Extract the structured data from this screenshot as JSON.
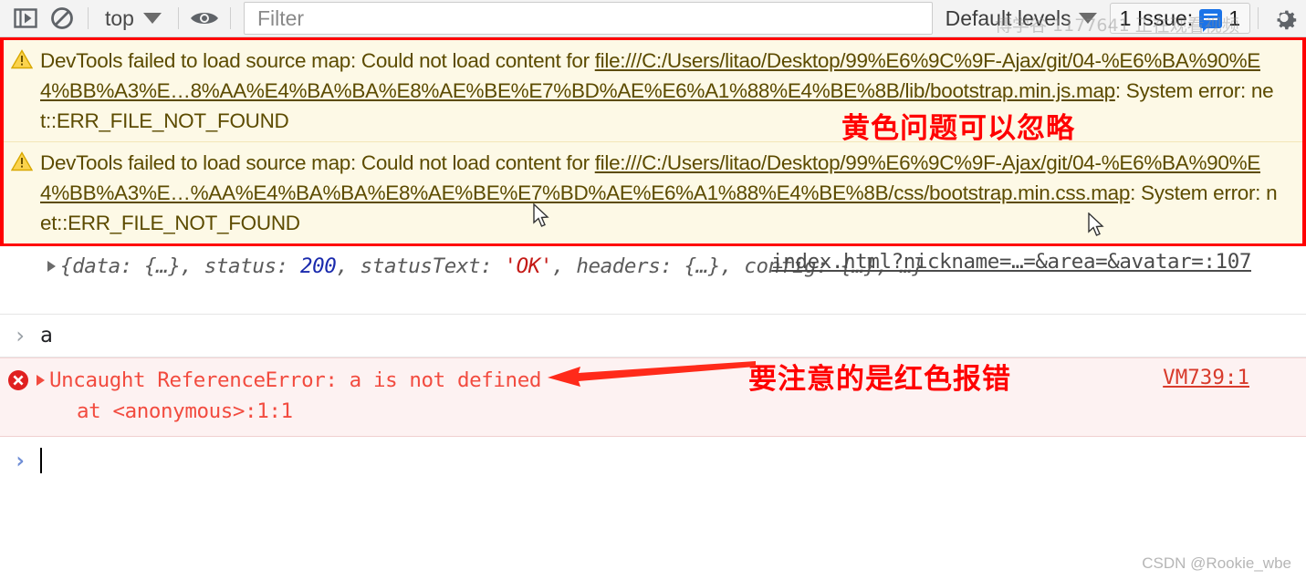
{
  "toolbar": {
    "sidebar_toggle_icon": "sidebar-play-icon",
    "clear_console_icon": "clear-console-icon",
    "context_label": "top",
    "context_caret_icon": "chevron-down-icon",
    "eye_icon": "eye-icon",
    "filter_placeholder": "Filter",
    "filter_value": "",
    "levels_label": "Default levels",
    "levels_caret_icon": "chevron-down-icon",
    "issues_label": "1 Issue:",
    "issues_chip_icon": "issue-message-icon",
    "issues_count": "1",
    "settings_icon": "gear-icon"
  },
  "console": {
    "warnings": [
      {
        "icon": "warning-triangle-icon",
        "prefix": "DevTools failed to load source map: Could not load content for ",
        "link": "file:///C:/Users/litao/Desktop/99%E6%9C%9F-Ajax/git/04-%E6%BA%90%E4%BB%A3%E…8%AA%E4%BA%BA%E8%AE%BE%E7%BD%AE%E6%A1%88%E4%BE%8B/lib/bootstrap.min.js.map",
        "suffix": ": System error: net::ERR_FILE_NOT_FOUND"
      },
      {
        "icon": "warning-triangle-icon",
        "prefix": "DevTools failed to load source map: Could not load content for ",
        "link": "file:///C:/Users/litao/Desktop/99%E6%9C%9F-Ajax/git/04-%E6%BA%90%E4%BB%A3%E…%AA%E4%BA%BA%E8%AE%BE%E7%BD%AE%E6%A1%88%E4%BE%8B/css/bootstrap.min.css.map",
        "suffix": ": System error: net::ERR_FILE_NOT_FOUND"
      }
    ],
    "object_result": {
      "source_link": "index.html?nickname=…=&area=&avatar=:107",
      "part1": "{data: {…}, status: ",
      "status_value": "200",
      "part2": ", statusText: ",
      "status_text_value": "'OK'",
      "part3": ", headers: {…}, config: {…}, …}"
    },
    "user_input": {
      "prompt": "›",
      "text": "a"
    },
    "error": {
      "icon": "error-circle-icon",
      "line1": "Uncaught ReferenceError: a is not defined",
      "line2": "at <anonymous>:1:1",
      "source_link": "VM739:1"
    },
    "empty_prompt": {
      "prompt": "›",
      "value": ""
    }
  },
  "annotations": [
    {
      "name": "yellow-note",
      "text": "黄色问题可以忽略"
    },
    {
      "name": "red-note",
      "text": "要注意的是红色报错"
    }
  ],
  "watermarks": {
    "top": "博学谷 1177641 正在观看视频",
    "bottom": "CSDN @Rookie_wbe"
  },
  "colors": {
    "annotation_red": "#ff0000",
    "warning_bg": "#fdf9e6",
    "error_bg": "#fdf2f2",
    "error_text": "#f24b3f",
    "highlight_border": "#ff0000",
    "link_blue": "#1a73e8"
  }
}
